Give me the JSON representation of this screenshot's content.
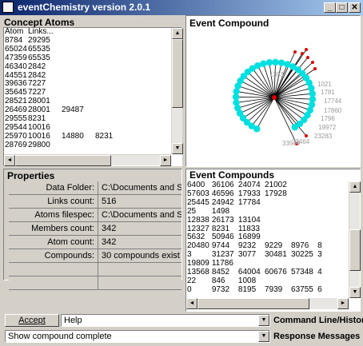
{
  "window": {
    "title": "eventChemistry  version 2.0.1",
    "min": "_",
    "max": "□",
    "close": "✕"
  },
  "atoms": {
    "title": "Concept Atoms",
    "headers": [
      "Atom",
      "Links..."
    ],
    "rows": [
      [
        "8784",
        "29295",
        "",
        ""
      ],
      [
        "65024",
        "65535",
        "",
        ""
      ],
      [
        "47359",
        "65535",
        "",
        ""
      ],
      [
        "46340",
        "2842",
        "",
        ""
      ],
      [
        "44551",
        "2842",
        "",
        ""
      ],
      [
        "39636",
        "7227",
        "",
        ""
      ],
      [
        "35645",
        "7227",
        "",
        ""
      ],
      [
        "28521",
        "28001",
        "",
        ""
      ],
      [
        "26469",
        "28001",
        "29487",
        ""
      ],
      [
        "29555",
        "8231",
        "",
        ""
      ],
      [
        "29544",
        "10016",
        "",
        ""
      ],
      [
        "25970",
        "10016",
        "14880",
        "8231"
      ],
      [
        "28769",
        "29800",
        "",
        ""
      ]
    ]
  },
  "event_compound": {
    "title": "Event Compound",
    "node_color": "#00e0e0",
    "hub_color": "#e00000",
    "labels": [
      "1021",
      "1781",
      "17744",
      "17860",
      "1796",
      "19972",
      "23283",
      "33539",
      "33464",
      "1393"
    ]
  },
  "properties": {
    "title": "Properties",
    "rows": [
      {
        "label": "Data Folder:",
        "value": "C:\\Documents and S"
      },
      {
        "label": "Links count:",
        "value": "516"
      },
      {
        "label": "Atoms filespec:",
        "value": "C:\\Documents and S"
      },
      {
        "label": "Members count:",
        "value": "342"
      },
      {
        "label": "Atom count:",
        "value": "342"
      },
      {
        "label": "Compounds:",
        "value": "30 compounds exist"
      },
      {
        "label": "",
        "value": ""
      },
      {
        "label": "",
        "value": ""
      }
    ]
  },
  "compounds": {
    "title": "Event Compounds",
    "rows": [
      [
        "6400",
        "36106",
        "24074",
        "21002",
        "",
        "",
        ""
      ],
      [
        "57603",
        "46596",
        "17933",
        "17928",
        "",
        "",
        ""
      ],
      [
        "25445",
        "24942",
        "17784",
        "",
        "",
        "",
        ""
      ],
      [
        "25",
        "1498",
        "",
        "",
        "",
        "",
        ""
      ],
      [
        "12838",
        "26173",
        "13104",
        "",
        "",
        "",
        ""
      ],
      [
        "12327",
        "8231",
        "11833",
        "",
        "",
        "",
        ""
      ],
      [
        "5632",
        "50946",
        "16899",
        "",
        "",
        "",
        ""
      ],
      [
        "20480",
        "9744",
        "9232",
        "9229",
        "8976",
        "8",
        ""
      ],
      [
        "3",
        "31237",
        "3077",
        "30481",
        "30225",
        "3",
        ""
      ],
      [
        "19809",
        "11786",
        "",
        "",
        "",
        "",
        ""
      ],
      [
        "13568",
        "8452",
        "64004",
        "60676",
        "57348",
        "4",
        ""
      ],
      [
        "22",
        "846",
        "1008",
        "",
        "",
        "",
        ""
      ],
      [
        "0",
        "9732",
        "8195",
        "7939",
        "63755",
        "6",
        ""
      ]
    ]
  },
  "bottom": {
    "accept_label": "Accept",
    "command_value": "Help",
    "command_label": "Command Line/History",
    "response_value": "Show compound complete",
    "response_label": "Response Messages"
  },
  "icons": {
    "scroll_up": "▲",
    "scroll_down": "▼",
    "scroll_left": "◄",
    "scroll_right": "►",
    "dropdown": "▼"
  }
}
